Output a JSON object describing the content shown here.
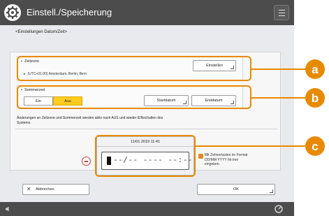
{
  "window": {
    "title": "Einstell./Speicherung",
    "breadcrumb": "<Einstellungen Datum/Zeit>",
    "menu_icon": "menu-icon"
  },
  "timezone": {
    "label": "Zeitzone",
    "value": "(UTC+01:00) Amsterdam, Berlin, Bern",
    "set_button": "Einstellen"
  },
  "dst": {
    "label": "Sommerzeit",
    "on_label": "Ein",
    "off_label": "Aus",
    "selected": "Aus",
    "start_date_button": "Startdatum",
    "end_date_button": "Enddatum"
  },
  "info": "Änderungen an Zeitzone und Sommerzeit werden aktiv nach AUS und wieder EINschalten des Systems.",
  "datetime": {
    "current": "11/01 2019 11:41",
    "input_mask": "--/-- ---- --:--"
  },
  "note": "Mit Zehnertasten im Format DD/MM YYYY hh:mm eingeben.",
  "footer": {
    "cancel_label": "Abbrechen",
    "ok_label": "OK"
  },
  "callouts": [
    "a",
    "b",
    "c"
  ],
  "colors": {
    "title_bar": "#4c4c4c",
    "accent": "#e88a00",
    "selected_toggle": "#ffcc1f",
    "error": "#d23a3a"
  }
}
